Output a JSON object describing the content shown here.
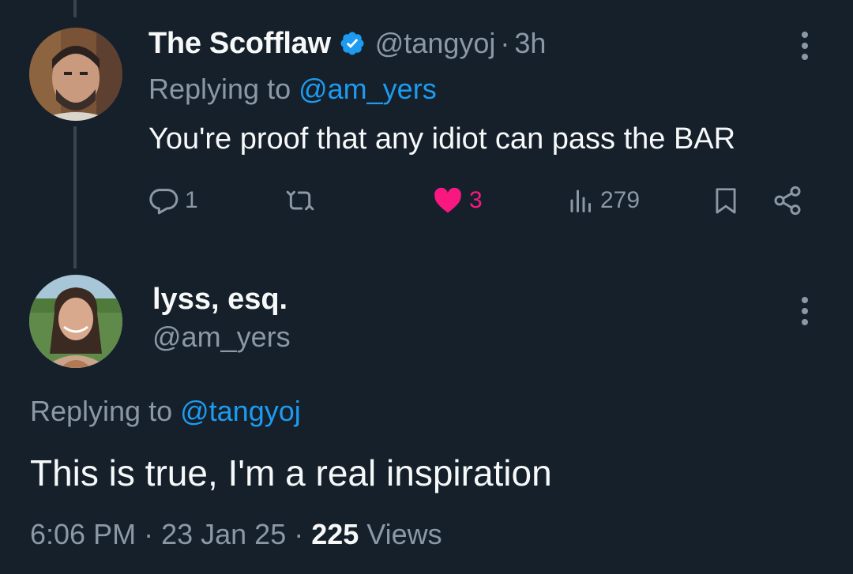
{
  "tweet1": {
    "display_name": "The Scofflaw",
    "handle": "@tangyoj",
    "separator": "·",
    "time": "3h",
    "replying_prefix": "Replying to ",
    "replying_to": "@am_yers",
    "text": "You're proof that any idiot can pass the BAR",
    "actions": {
      "reply_count": "1",
      "retweet_count": "",
      "like_count": "3",
      "view_count": "279"
    },
    "icons": [
      "verified-badge-icon",
      "more-icon",
      "reply-icon",
      "retweet-icon",
      "like-icon",
      "views-icon",
      "bookmark-icon",
      "share-icon"
    ]
  },
  "tweet2": {
    "display_name": "lyss, esq.",
    "handle": "@am_yers",
    "replying_prefix": "Replying to ",
    "replying_to": "@tangyoj",
    "text": "This is true, I'm a real inspiration",
    "meta": {
      "time": "6:06 PM",
      "sep1": " · ",
      "date": "23 Jan 25",
      "sep2": " · ",
      "views_count": "225",
      "views_label": " Views"
    }
  },
  "colors": {
    "background": "#15202b",
    "text_primary": "#f7f9f9",
    "text_secondary": "#8b98a5",
    "accent_blue": "#1d9bf0",
    "like_pink": "#f91880",
    "thread_line": "#38444d"
  }
}
